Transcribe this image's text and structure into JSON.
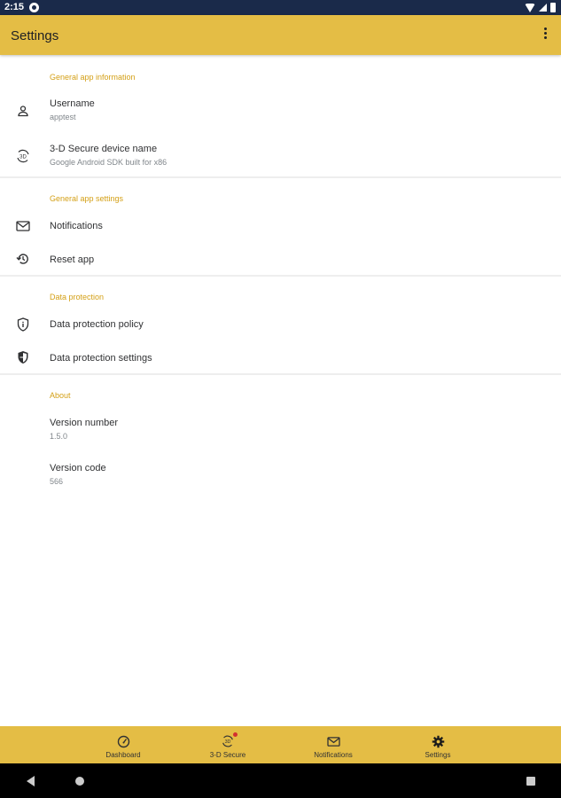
{
  "status_bar": {
    "time": "2:15"
  },
  "app_bar": {
    "title": "Settings"
  },
  "sections": [
    {
      "header": "General app information",
      "items": [
        {
          "title": "Username",
          "subtitle": "apptest",
          "icon": "person-icon"
        },
        {
          "title": "3-D Secure device name",
          "subtitle": "Google Android SDK built for x86",
          "icon": "3d-secure-icon"
        }
      ]
    },
    {
      "header": "General app settings",
      "items": [
        {
          "title": "Notifications",
          "icon": "mail-icon"
        },
        {
          "title": "Reset app",
          "icon": "history-icon"
        }
      ]
    },
    {
      "header": "Data protection",
      "items": [
        {
          "title": "Data protection policy",
          "icon": "shield-info-icon"
        },
        {
          "title": "Data protection settings",
          "icon": "shield-filled-icon"
        }
      ]
    },
    {
      "header": "About",
      "items": [
        {
          "title": "Version number",
          "subtitle": "1.5.0"
        },
        {
          "title": "Version code",
          "subtitle": "566"
        }
      ]
    }
  ],
  "bottom_nav": [
    {
      "label": "Dashboard",
      "icon": "speedometer-icon"
    },
    {
      "label": "3-D Secure",
      "icon": "3d-secure-icon",
      "badge": true
    },
    {
      "label": "Notifications",
      "icon": "mail-icon"
    },
    {
      "label": "Settings",
      "icon": "gear-icon",
      "active": true
    }
  ],
  "colors": {
    "accent": "#e4bd45",
    "section_header": "#d4a017",
    "status_bar": "#1a2a4a"
  }
}
